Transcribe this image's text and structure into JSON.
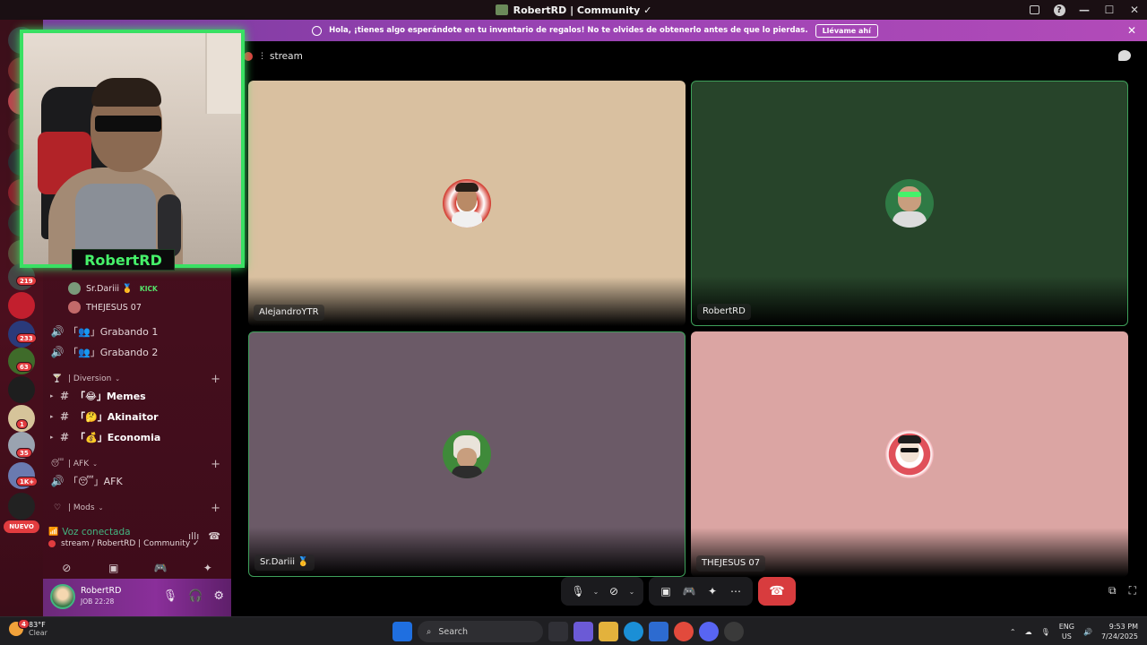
{
  "window": {
    "title": "RobertRD | Community ✓"
  },
  "notice": {
    "text": "Hola, ¡tienes algo esperándote en tu inventario de regalos! No te olvides de obtenerlo antes de que lo pierdas.",
    "button": "Llévame ahí"
  },
  "webcam": {
    "name": "RobertRD"
  },
  "rail": {
    "badges": [
      "219",
      "233",
      "63",
      "1",
      "35",
      "1K+"
    ],
    "new_label": "NUEVO"
  },
  "sidebar": {
    "voice_users": [
      {
        "name": "Sr.Dariii 🥇",
        "tag": "KICK"
      },
      {
        "name": "THEJESUS 07",
        "tag": ""
      }
    ],
    "voice_channels": [
      {
        "name": "「👥」Grabando 1"
      },
      {
        "name": "「👥」Grabando 2"
      }
    ],
    "category_diversion": "| Diversion",
    "text_channels": [
      {
        "name": "「😂」Memes"
      },
      {
        "name": "「🤔」Akinaitor"
      },
      {
        "name": "「💰」Economia"
      }
    ],
    "category_afk": "| AFK",
    "afk_channel": "「😴」AFK",
    "category_mods": "| Mods"
  },
  "voice": {
    "status": "Voz conectada",
    "channel": "stream / RobertRD | Community ✓"
  },
  "user": {
    "name": "RobertRD",
    "status": "JOB 22:28"
  },
  "stage": {
    "channel": "stream",
    "tiles": [
      {
        "name": "AlejandroYTR",
        "bg": "#d9c0a0"
      },
      {
        "name": "RobertRD",
        "bg": "#27442a"
      },
      {
        "name": "Sr.Dariii 🥇",
        "bg": "#6b5a67"
      },
      {
        "name": "THEJESUS 07",
        "bg": "#dba5a3"
      }
    ]
  },
  "taskbar": {
    "weather_temp": "83°F",
    "weather_cond": "Clear",
    "weather_badge": "4",
    "search": "Search",
    "lang1": "ENG",
    "lang2": "US",
    "time": "9:53 PM",
    "date": "7/24/2025"
  },
  "colors": {
    "accent_green": "#39e063",
    "hangup_red": "#d83c3e",
    "banner_purple": "#9b43b4"
  }
}
